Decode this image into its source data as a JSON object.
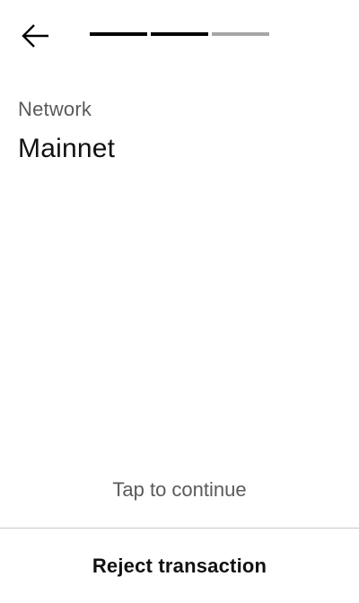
{
  "header": {
    "back_icon": "arrow-left-icon",
    "progress": {
      "total_steps": 3,
      "completed_steps": 2,
      "active_color": "#000000",
      "inactive_color": "#a6a6a6"
    }
  },
  "main": {
    "label": "Network",
    "value": "Mainnet"
  },
  "footer": {
    "hint": "Tap to continue",
    "reject_label": "Reject transaction"
  }
}
